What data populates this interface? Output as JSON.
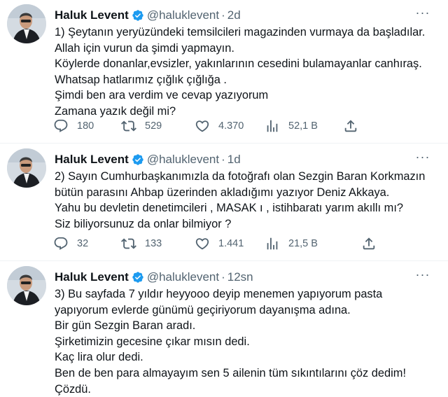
{
  "colors": {
    "text": "#0f1419",
    "secondary": "#536471",
    "verified": "#1d9bf0",
    "divider": "#eff3f4"
  },
  "tweets": [
    {
      "name": "Haluk Levent",
      "handle": "@haluklevent",
      "separator": "·",
      "time": "2d",
      "lines": [
        "1) Şeytanın yeryüzündeki temsilcileri magazinden vurmaya da başladılar.",
        "Allah için vurun da şimdi yapmayın.",
        "Köylerde donanlar,evsizler, yakınlarının cesedini bulamayanlar canhıraş.",
        "Whatsap hatlarımız çığlık çığlığa .",
        "Şimdi ben ara verdim ve cevap yazıyorum",
        "Zamana yazık değil mi?"
      ],
      "replies": "180",
      "retweets": "529",
      "likes": "4.370",
      "views": "52,1 B"
    },
    {
      "name": "Haluk Levent",
      "handle": "@haluklevent",
      "separator": "·",
      "time": "1d",
      "lines": [
        "2) Sayın Cumhurbaşkanımızla da fotoğrafı olan Sezgin Baran Korkmazın",
        "bütün parasını Ahbap üzerinden akladığımı yazıyor Deniz Akkaya.",
        "Yahu bu devletin denetimcileri , MASAK ı , istihbaratı yarım akıllı mı?",
        "Siz biliyorsunuz da onlar bilmiyor ?"
      ],
      "replies": "32",
      "retweets": "133",
      "likes": "1.441",
      "views": "21,5 B"
    },
    {
      "name": "Haluk Levent",
      "handle": "@haluklevent",
      "separator": "·",
      "time": "12sn",
      "lines": [
        "3) Bu sayfada 7 yıldır heyyooo deyip menemen yapıyorum pasta",
        "yapıyorum evlerde günümü geçiriyorum dayanışma adına.",
        "Bir gün Sezgin Baran aradı.",
        "Şirketimizin gecesine çıkar mısın dedi.",
        "Kaç lira olur dedi.",
        "Ben de ben para almayayım sen 5 ailenin tüm sıkıntılarını çöz dedim!",
        "Çözdü."
      ]
    }
  ]
}
